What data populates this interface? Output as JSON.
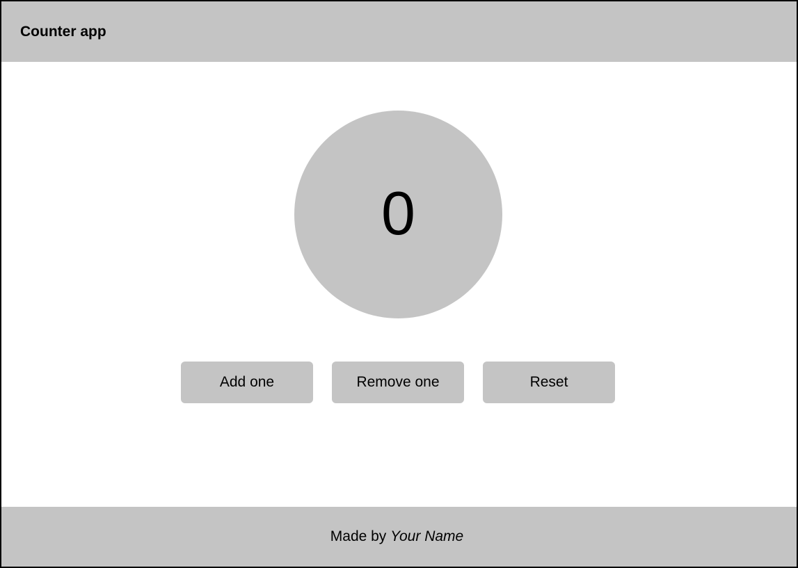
{
  "header": {
    "title": "Counter app"
  },
  "counter": {
    "value": "0"
  },
  "buttons": {
    "add_label": "Add one",
    "remove_label": "Remove one",
    "reset_label": "Reset"
  },
  "footer": {
    "prefix": "Made by ",
    "name": "Your Name"
  },
  "colors": {
    "panel": "#c4c4c4",
    "background": "#ffffff",
    "text": "#000000",
    "border": "#000000"
  }
}
